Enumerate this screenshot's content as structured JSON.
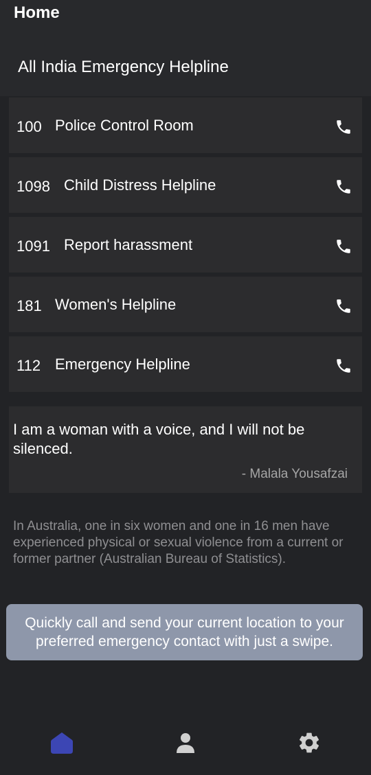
{
  "header": {
    "title": "Home",
    "section_title": "All India Emergency Helpline"
  },
  "helplines": [
    {
      "number": "100",
      "name": "Police Control Room"
    },
    {
      "number": "1098",
      "name": "Child Distress Helpline"
    },
    {
      "number": "1091",
      "name": "Report harassment"
    },
    {
      "number": "181",
      "name": "Women's Helpline"
    },
    {
      "number": "112",
      "name": "Emergency Helpline"
    }
  ],
  "quote": {
    "text": "I am a woman with a voice, and I will not be silenced.",
    "author": "- Malala Yousafzai"
  },
  "statistic": "In Australia, one in six women and one in 16 men have experienced physical or sexual violence from a current or former partner (Australian Bureau of Statistics).",
  "swipe_banner": "Quickly call and send your current location to your preferred emergency contact with just a swipe.",
  "nav": {
    "items": [
      {
        "icon": "home-icon",
        "color": "#3c46b4"
      },
      {
        "icon": "person-icon",
        "color": "#d0d0d0"
      },
      {
        "icon": "gear-icon",
        "color": "#d0d0d0"
      }
    ]
  },
  "colors": {
    "background": "#222326",
    "card": "#2c2c2e",
    "banner": "#8e97aa",
    "accent": "#3c46b4"
  }
}
